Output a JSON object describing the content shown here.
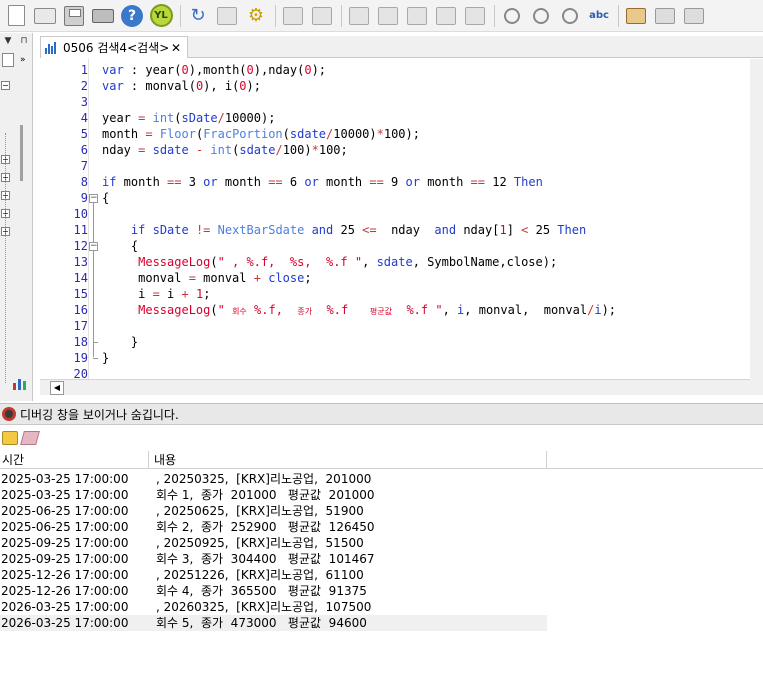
{
  "toolbar": {
    "icons": [
      "new-document-icon",
      "open-folder-icon",
      "save-icon",
      "print-icon",
      "help-icon",
      "yl-icon",
      "refresh-icon",
      "spellcheck-icon",
      "gear-icon",
      "grid-icon",
      "grid-edit-icon",
      "cut-icon",
      "paste-icon",
      "copy-icon",
      "delete-icon",
      "window-icon",
      "find-icon",
      "find-next-icon",
      "replace-icon",
      "abc-icon",
      "book-icon",
      "book-prev-icon",
      "book-next-icon"
    ],
    "yl_label": "YL",
    "help_label": "?",
    "abc_label": "abc"
  },
  "tab": {
    "label": "0506 검색4<검색>",
    "close": "✕"
  },
  "editor": {
    "lines": [
      {
        "n": "1",
        "html": "<span class='k'>var</span> : year(<span class='f'>0</span>),month(<span class='f'>0</span>),nday(<span class='f'>0</span>);"
      },
      {
        "n": "2",
        "html": "<span class='k'>var</span> : monval(<span class='f'>0</span>), i(<span class='f'>0</span>);"
      },
      {
        "n": "3",
        "html": ""
      },
      {
        "n": "4",
        "html": "year <span class='o'>=</span> <span class='fb'>int</span>(<span class='k'>sDate</span><span class='o'>/</span>10000);"
      },
      {
        "n": "5",
        "html": "month <span class='o'>=</span> <span class='fb'>Floor</span>(<span class='fb'>FracPortion</span>(<span class='k'>sdate</span><span class='o'>/</span>10000)<span class='o'>*</span>100);"
      },
      {
        "n": "6",
        "html": "nday <span class='o'>=</span> <span class='k'>sdate</span> <span class='o'>-</span> <span class='fb'>int</span>(<span class='k'>sdate</span><span class='o'>/</span>100)<span class='o'>*</span>100;"
      },
      {
        "n": "7",
        "html": ""
      },
      {
        "n": "8",
        "html": "<span class='k'>if</span> month <span class='o'>==</span> 3 <span class='k'>or</span> month <span class='o'>==</span> 6 <span class='k'>or</span> month <span class='o'>==</span> 9 <span class='k'>or</span> month <span class='o'>==</span> 12 <span class='k'>Then</span>"
      },
      {
        "n": "9",
        "html": "{"
      },
      {
        "n": "10",
        "html": ""
      },
      {
        "n": "11",
        "html": "    <span class='k'>if</span> <span class='k'>sDate</span> <span class='o'>!=</span> <span class='fb'>NextBarSdate</span> <span class='k'>and</span> 25 <span class='o'>&lt;=</span>  nday  <span class='k'>and</span> nday[<span class='f'>1</span>] <span class='o'>&lt;</span> 25 <span class='k'>Then</span>"
      },
      {
        "n": "12",
        "html": "    {"
      },
      {
        "n": "13",
        "html": "     <span class='f'>MessageLog</span>(<span class='s'>\" , %.f,  %s,  %.f \"</span>, <span class='k'>sdate</span>, <span class='v'>SymbolName</span>,<span class='v'>close</span>);"
      },
      {
        "n": "14",
        "html": "     monval <span class='o'>=</span> monval <span class='o'>+</span> <span class='k'>close</span>;"
      },
      {
        "n": "15",
        "html": "     i <span class='o'>=</span> i <span class='o'>+</span> <span class='f'>1</span>;"
      },
      {
        "n": "16",
        "html": "     <span class='f'>MessageLog</span>(<span class='s'>\" </span><span class='s2'>회수</span><span class='s'> %.f,  </span><span class='s2'>종가</span><span class='s'>  %.f   </span><span class='s2'>평균값</span><span class='s'>  %.f \"</span>, <span class='k'>i</span>, monval,  monval<span class='o'>/</span><span class='k'>i</span>);"
      },
      {
        "n": "17",
        "html": ""
      },
      {
        "n": "18",
        "html": "    }"
      },
      {
        "n": "19",
        "html": "}"
      },
      {
        "n": "20",
        "html": ""
      }
    ]
  },
  "debug": {
    "header": "디버깅 창을 보이거나 숨깁니다.",
    "columns": {
      "time": "시간",
      "message": "내용"
    },
    "rows": [
      {
        "time": "2025-03-25 17:00:00",
        "msg": ", 20250325,  [KRX]리노공업,  201000"
      },
      {
        "time": "2025-03-25 17:00:00",
        "msg": "회수 1,  종가  201000   평균값  201000"
      },
      {
        "time": "2025-06-25 17:00:00",
        "msg": ", 20250625,  [KRX]리노공업,  51900"
      },
      {
        "time": "2025-06-25 17:00:00",
        "msg": "회수 2,  종가  252900   평균값  126450"
      },
      {
        "time": "2025-09-25 17:00:00",
        "msg": ", 20250925,  [KRX]리노공업,  51500"
      },
      {
        "time": "2025-09-25 17:00:00",
        "msg": "회수 3,  종가  304400   평균값  101467"
      },
      {
        "time": "2025-12-26 17:00:00",
        "msg": ", 20251226,  [KRX]리노공업,  61100"
      },
      {
        "time": "2025-12-26 17:00:00",
        "msg": "회수 4,  종가  365500   평균값  91375"
      },
      {
        "time": "2026-03-25 17:00:00",
        "msg": ", 20260325,  [KRX]리노공업,  107500"
      },
      {
        "time": "2026-03-25 17:00:00",
        "msg": "회수 5,  종가  473000   평균값  94600"
      }
    ]
  }
}
